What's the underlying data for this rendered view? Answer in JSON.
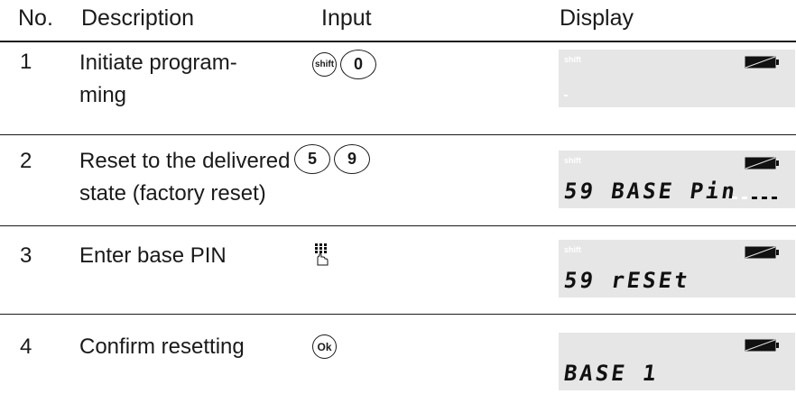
{
  "header": {
    "no": "No.",
    "description": "Description",
    "input": "Input",
    "display": "Display"
  },
  "steps": [
    {
      "no": "1",
      "description_line1": "Initiate program-",
      "description_line2": "ming",
      "keys": [
        "shift",
        "0"
      ],
      "lcd_shift": "shift",
      "lcd_text": ""
    },
    {
      "no": "2",
      "description_line1": "Reset to the delivered",
      "description_line2": "state (factory reset)",
      "keys": [
        "5",
        "9"
      ],
      "lcd_shift": "shift",
      "lcd_text": "59 BASE Pin"
    },
    {
      "no": "3",
      "description_line1": "Enter base PIN",
      "input_icon": "keypad-icon",
      "lcd_shift": "shift",
      "lcd_text": "59 rESEt"
    },
    {
      "no": "4",
      "description_line1": "Confirm resetting",
      "keys": [
        "Ok"
      ],
      "lcd_text": "BASE 1"
    }
  ],
  "colors": {
    "lcd_background": "#e6e6e6",
    "text": "#1a1a1a"
  }
}
